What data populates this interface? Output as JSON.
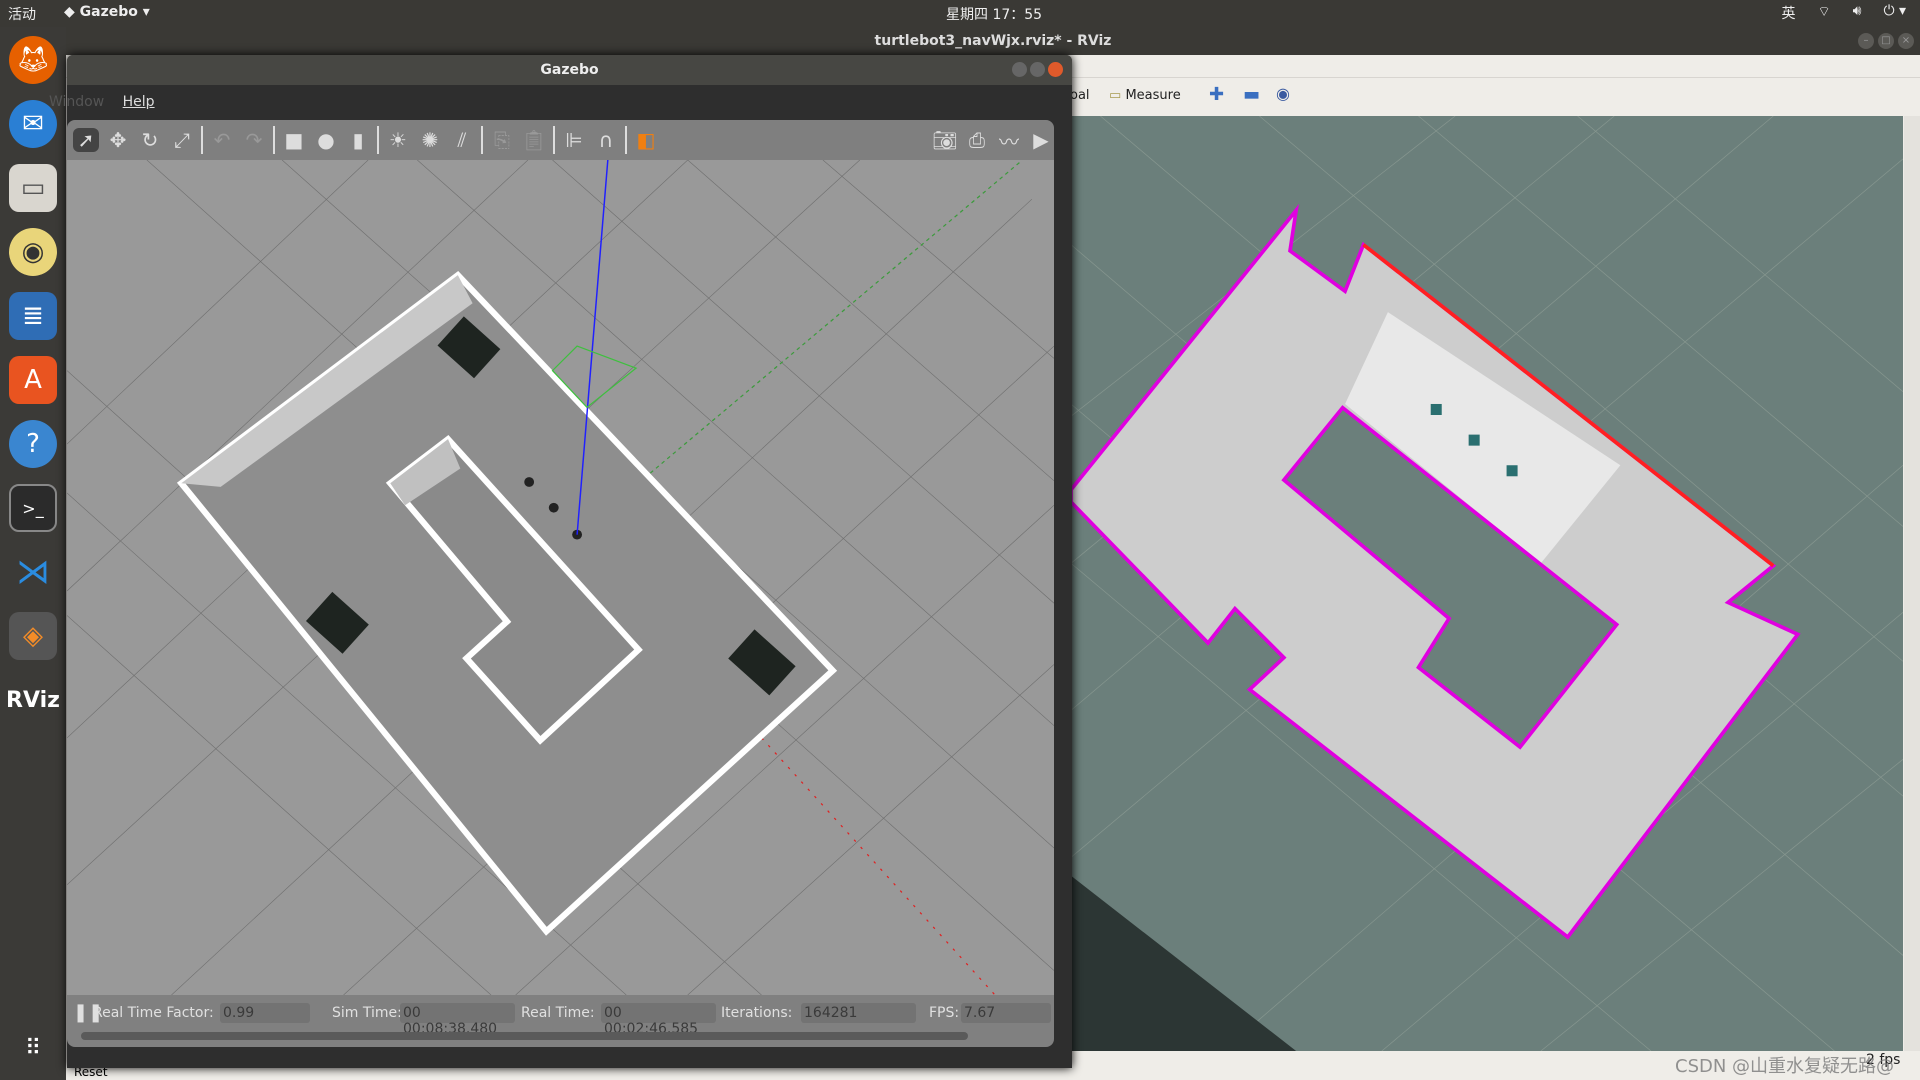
{
  "topbar": {
    "activities": "活动",
    "app_menu": "Gazebo",
    "clock": "星期四 17：55",
    "input_method": "英",
    "icons": [
      "wifi-icon",
      "volume-icon",
      "power-icon"
    ]
  },
  "dock": {
    "items": [
      "firefox",
      "thunderbird",
      "files",
      "rhythmbox",
      "libreoffice-writer",
      "ubuntu-software",
      "help",
      "terminal",
      "vscode",
      "gazebo",
      "rviz",
      "show-applications"
    ],
    "rviz_label": "RViz"
  },
  "rviz": {
    "title": "turtlebot3_navWjx.rviz* - RViz",
    "tools": {
      "goal_partial": "oal",
      "measure": "Measure"
    },
    "fps": "2 fps",
    "hidden_button": "Reset"
  },
  "gazebo": {
    "title": "Gazebo",
    "menu": {
      "window": "Window",
      "help": "Help"
    },
    "status": {
      "rtf_label": "Real Time Factor:",
      "rtf": "0.99",
      "sim_label": "Sim Time:",
      "sim": "00 00:08:38.480",
      "real_label": "Real Time:",
      "real": "00 00:02:46.585",
      "iter_label": "Iterations:",
      "iter": "164281",
      "fps_label": "FPS:",
      "fps": "7.67"
    }
  },
  "watermark": "CSDN @山重水复疑无路@",
  "colors": {
    "map_border": "#e000e0",
    "rviz_bg": "#6b7f7b",
    "gazebo_ground": "#999999"
  }
}
